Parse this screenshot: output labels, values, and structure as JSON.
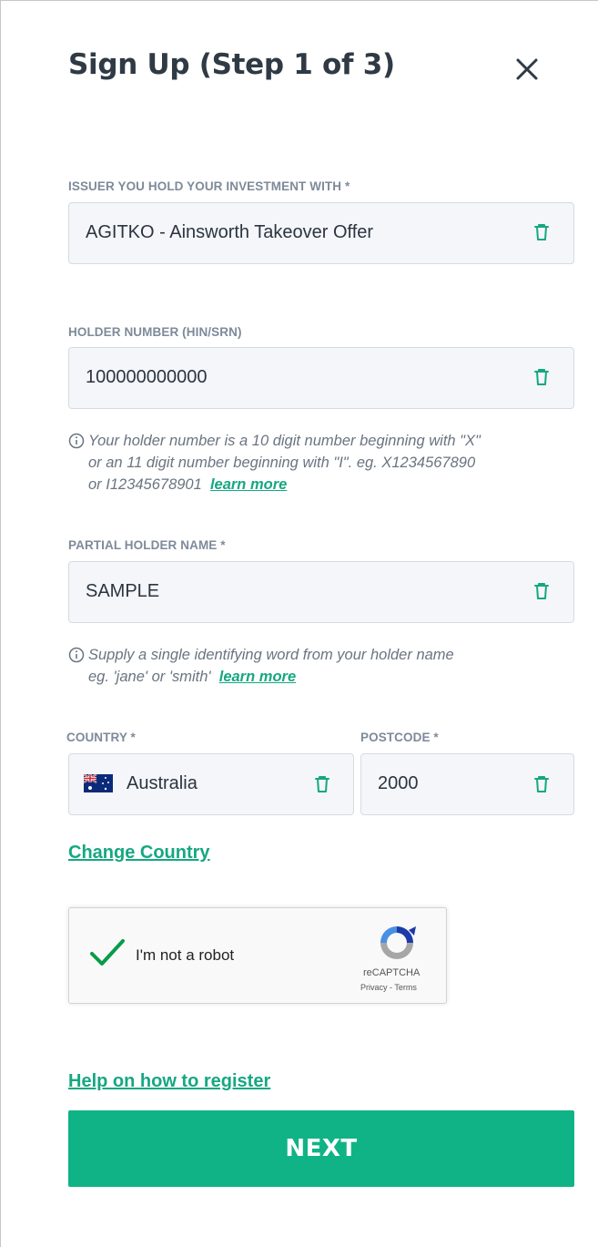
{
  "header": {
    "title": "Sign Up (Step 1 of 3)"
  },
  "issuer": {
    "label": "ISSUER YOU HOLD YOUR INVESTMENT WITH *",
    "value": "AGITKO - Ainsworth Takeover Offer"
  },
  "holder_number": {
    "label": "HOLDER NUMBER (HIN/SRN)",
    "value": "100000000000",
    "hint_lines": [
      "Your holder number is a 10 digit number beginning with \"X\"",
      "or an 11 digit number beginning with \"I\". eg. X1234567890",
      "or I12345678901"
    ],
    "learn_more": "learn more"
  },
  "partial_name": {
    "label": "PARTIAL HOLDER NAME *",
    "value": "SAMPLE",
    "hint_lines": [
      "Supply a single identifying word from your holder name",
      "eg. 'jane' or 'smith'"
    ],
    "learn_more": "learn more"
  },
  "country": {
    "label": "COUNTRY *",
    "value": "Australia"
  },
  "postcode": {
    "label": "POSTCODE *",
    "value": "2000"
  },
  "change_country": "Change Country",
  "captcha": {
    "label": "I'm not a robot",
    "brand": "reCAPTCHA",
    "terms": "Privacy - Terms"
  },
  "help_link": "Help on how to register",
  "next_button": "NEXT",
  "colors": {
    "accent": "#10b385",
    "link": "#16a782",
    "field_bg": "#f4f6f9",
    "label": "#7e8a9a"
  }
}
